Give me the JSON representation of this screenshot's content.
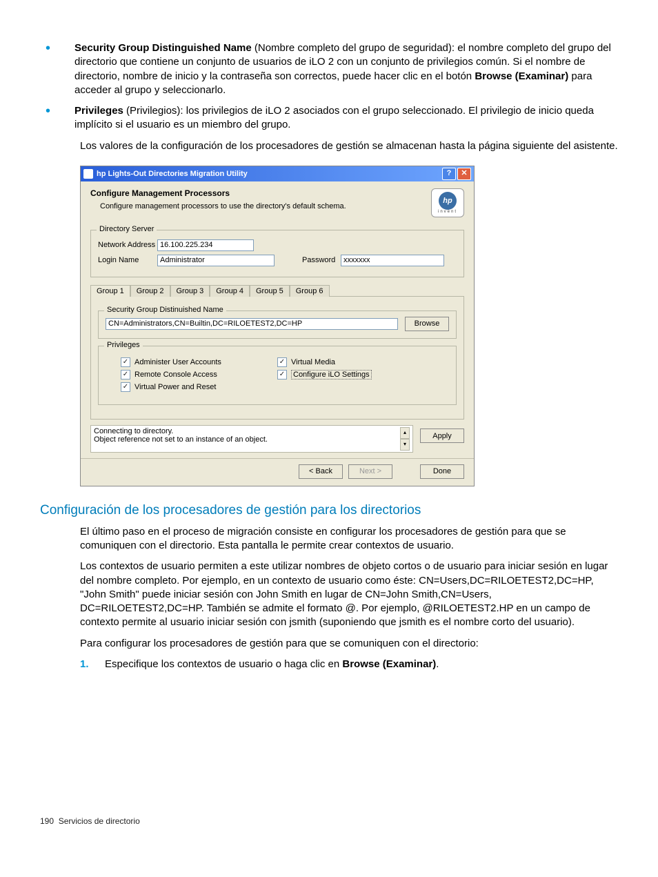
{
  "bullets": {
    "sgdn_label": "Security Group Distinguished Name",
    "sgdn_rest": " (Nombre completo del grupo de seguridad): el nombre completo del grupo del directorio que contiene un conjunto de usuarios de iLO 2 con un conjunto de privilegios común. Si el nombre de directorio, nombre de inicio y la contraseña son correctos, puede hacer clic en el botón ",
    "sgdn_browse": "Browse (Examinar)",
    "sgdn_tail": " para acceder al grupo y seleccionarlo.",
    "priv_label": "Privileges",
    "priv_rest": " (Privilegios): los privilegios de iLO 2 asociados con el grupo seleccionado. El privilegio de inicio queda implícito si el usuario es un miembro del grupo."
  },
  "para_after_bullets": "Los valores de la configuración de los procesadores de gestión se almacenan hasta la página siguiente del asistente.",
  "window": {
    "title": "hp Lights-Out Directories Migration Utility",
    "header_title": "Configure Management Processors",
    "header_sub": "Configure management processors to use the directory's default schema.",
    "hp_text": "hp",
    "hp_invent": "invent",
    "ds_label": "Directory Server",
    "net_label": "Network Address",
    "net_value": "16.100.225.234",
    "login_label": "Login Name",
    "login_value": "Administrator",
    "pwd_label": "Password",
    "pwd_value": "xxxxxxx",
    "tabs": [
      "Group 1",
      "Group 2",
      "Group 3",
      "Group 4",
      "Group 5",
      "Group 6"
    ],
    "sgdn_box_label": "Security Group Distinuished Name",
    "sgdn_value": "CN=Administrators,CN=Builtin,DC=RILOETEST2,DC=HP",
    "browse_btn": "Browse",
    "priv_box_label": "Privileges",
    "chk_admin": "Administer User Accounts",
    "chk_vmedia": "Virtual Media",
    "chk_remote": "Remote Console Access",
    "chk_config": "Configure iLO Settings",
    "chk_power": "Virtual Power and Reset",
    "status1": "Connecting to directory.",
    "status2": "Object reference not set to an instance of an object.",
    "apply": "Apply",
    "back": "< Back",
    "next": "Next >",
    "done": "Done"
  },
  "h2": "Configuración de los procesadores de gestión para los directorios",
  "p1": "El último paso en el proceso de migración consiste en configurar los procesadores de gestión para que se comuniquen con el directorio. Esta pantalla le permite crear contextos de usuario.",
  "p2": "Los contextos de usuario permiten a este utilizar nombres de objeto cortos o de usuario para iniciar sesión en lugar del nombre completo. Por ejemplo, en un contexto de usuario como éste: CN=Users,DC=RILOETEST2,DC=HP, \"John Smith\" puede iniciar sesión con John Smith en lugar de CN=John Smith,CN=Users, DC=RILOETEST2,DC=HP. También se admite el formato @. Por ejemplo, @RILOETEST2.HP en un campo de contexto permite al usuario iniciar sesión con jsmith (suponiendo que jsmith es el nombre corto del usuario).",
  "p3": "Para configurar los procesadores de gestión para que se comuniquen con el directorio:",
  "step1_num": "1.",
  "step1_a": "Especifique los contextos de usuario o haga clic en ",
  "step1_b": "Browse (Examinar)",
  "step1_c": ".",
  "footer_num": "190",
  "footer_text": "Servicios de directorio"
}
